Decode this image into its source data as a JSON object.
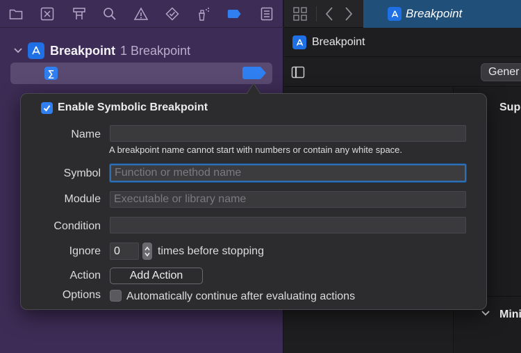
{
  "navigator": {
    "toolbar_icons": [
      "folder-icon",
      "x-square-icon",
      "hierarchy-icon",
      "search-icon",
      "warning-icon",
      "diamond-icon",
      "spray-icon",
      "breakpoint-icon",
      "list-icon"
    ],
    "group": {
      "title": "Breakpoint",
      "count": "1 Breakpoint"
    },
    "breakpoint_row": {
      "icon_glyph": "∑"
    }
  },
  "editor": {
    "tab": {
      "label": "Breakpoint"
    },
    "jumpbar": {
      "label": "Breakpoint"
    },
    "general_tab_label": "Gener",
    "section_1": "Sup",
    "section_2": "Mini"
  },
  "popover": {
    "enable_label": "Enable Symbolic Breakpoint",
    "enabled": true,
    "name": {
      "label": "Name",
      "value": "",
      "placeholder": ""
    },
    "name_hint": "A breakpoint name cannot start with numbers or contain any white space.",
    "symbol": {
      "label": "Symbol",
      "value": "",
      "placeholder": "Function or method name"
    },
    "module": {
      "label": "Module",
      "value": "",
      "placeholder": "Executable or library name"
    },
    "condition": {
      "label": "Condition",
      "value": "",
      "placeholder": ""
    },
    "ignore": {
      "label": "Ignore",
      "value": "0",
      "suffix": "times before stopping"
    },
    "action": {
      "label": "Action",
      "button": "Add Action"
    },
    "options": {
      "label": "Options",
      "checkbox_label": "Automatically continue after evaluating actions",
      "checked": false
    }
  },
  "colors": {
    "navigator_bg": "#3d2c55",
    "selection_bg": "#5a4a72",
    "accent_blue": "#2f7ff0",
    "active_tab": "#204f7a",
    "popover_bg": "#2c2c2e"
  }
}
